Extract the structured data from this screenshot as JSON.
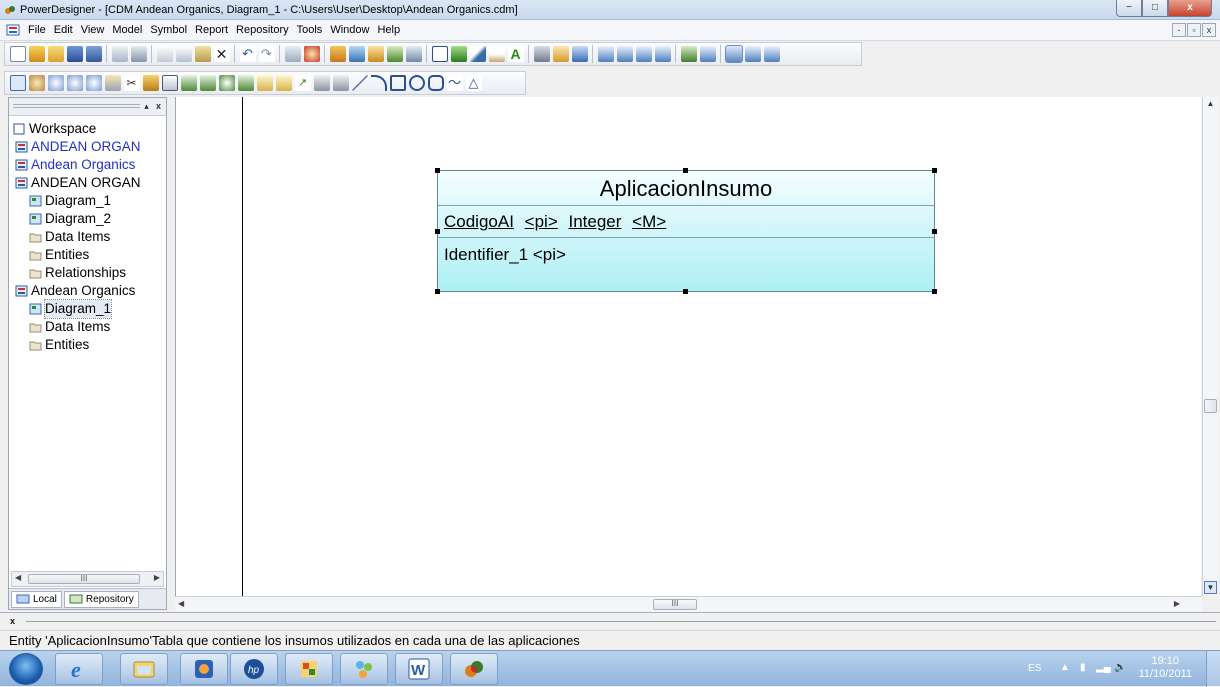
{
  "window": {
    "title": "PowerDesigner - [CDM Andean Organics, Diagram_1 - C:\\Users\\User\\Desktop\\Andean Organics.cdm]",
    "minimize": "−",
    "maximize": "□",
    "close": "x"
  },
  "menu": {
    "items": [
      "File",
      "Edit",
      "View",
      "Model",
      "Symbol",
      "Report",
      "Repository",
      "Tools",
      "Window",
      "Help"
    ],
    "mdi_min": "-",
    "mdi_restore": "▫",
    "mdi_close": "x"
  },
  "browser": {
    "close_btn": "x",
    "pin_btn": "▴",
    "tree": [
      {
        "label": "Workspace",
        "icon": "workspace-icon",
        "indent": 0,
        "blue": false
      },
      {
        "label": "ANDEAN ORGAN",
        "icon": "model-icon",
        "indent": 1,
        "blue": true
      },
      {
        "label": "Andean Organics",
        "icon": "model-icon",
        "indent": 1,
        "blue": true
      },
      {
        "label": "ANDEAN ORGAN",
        "icon": "model-icon",
        "indent": 1,
        "blue": false
      },
      {
        "label": "Diagram_1",
        "icon": "diagram-icon",
        "indent": 2,
        "blue": false
      },
      {
        "label": "Diagram_2",
        "icon": "diagram-icon",
        "indent": 2,
        "blue": false
      },
      {
        "label": "Data Items",
        "icon": "folder-icon",
        "indent": 2,
        "blue": false
      },
      {
        "label": "Entities",
        "icon": "folder-icon",
        "indent": 2,
        "blue": false
      },
      {
        "label": "Relationships",
        "icon": "folder-icon",
        "indent": 2,
        "blue": false
      },
      {
        "label": "Andean Organics",
        "icon": "model-icon",
        "indent": 1,
        "blue": false
      },
      {
        "label": "Diagram_1",
        "icon": "diagram-icon",
        "indent": 2,
        "blue": false,
        "selected": true
      },
      {
        "label": "Data Items",
        "icon": "folder-icon",
        "indent": 2,
        "blue": false
      },
      {
        "label": "Entities",
        "icon": "folder-icon",
        "indent": 2,
        "blue": false
      }
    ],
    "tabs": {
      "local": "Local",
      "repository": "Repository"
    },
    "scroll_grip": "III"
  },
  "entity": {
    "name": "AplicacionInsumo",
    "attribute": {
      "name": "CodigoAI",
      "key": "<pi>",
      "type": "Integer",
      "mandatory": "<M>"
    },
    "identifier": "Identifier_1 <pi>"
  },
  "canvas": {
    "scroll_grip": "III"
  },
  "output": {
    "close": "x"
  },
  "status": {
    "text": "Entity 'AplicacionInsumo'Tabla que contiene los insumos utilizados en cada una de las aplicaciones"
  },
  "taskbar": {
    "apps": [
      "internet-explorer",
      "file-explorer",
      "media-player",
      "hp-app",
      "paint-app",
      "people-app",
      "word",
      "powerdesigner"
    ],
    "language": "ES",
    "time": "19:10",
    "date": "11/10/2011"
  },
  "colors": {
    "entity_fill_top": "#f5feff",
    "entity_fill_bottom": "#aef0f5",
    "entity_border": "#5a8a96",
    "tree_link_blue": "#2030c8",
    "taskbar": "#a6c4e6"
  }
}
